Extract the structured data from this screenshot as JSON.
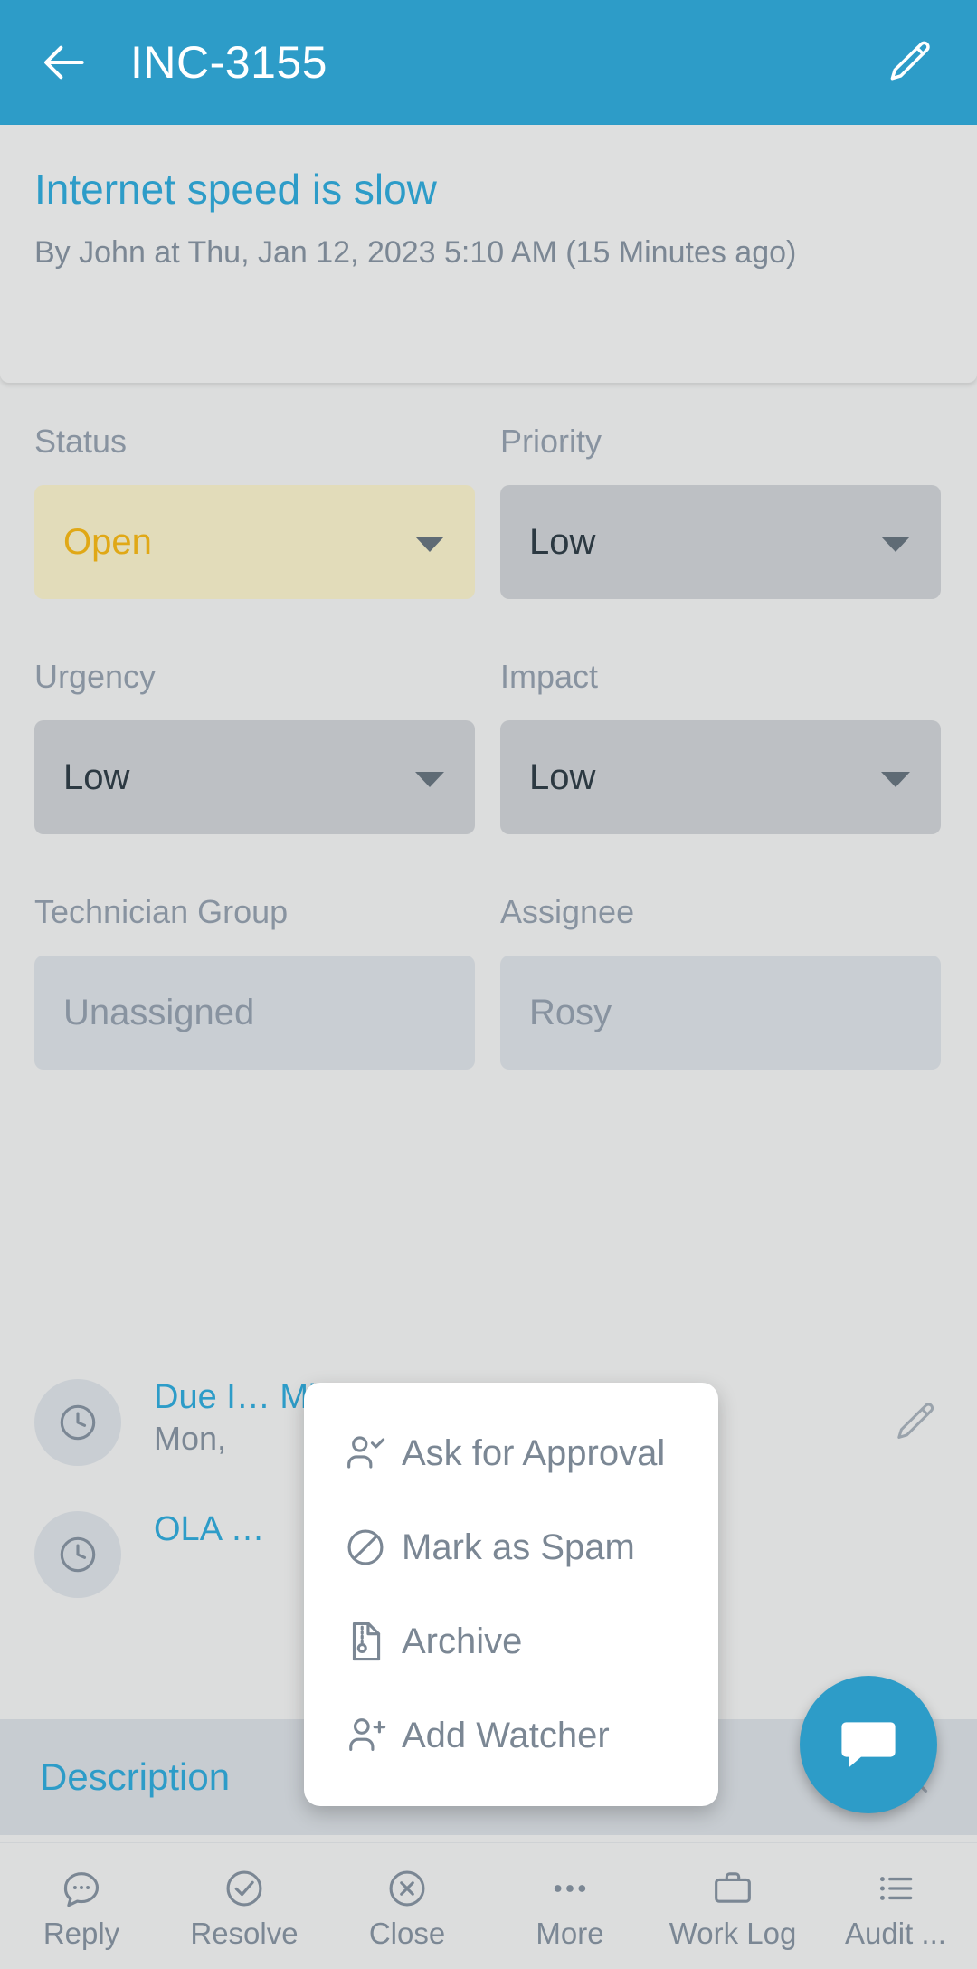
{
  "appbar": {
    "back_icon": "arrow-left-icon",
    "title": "INC-3155",
    "edit_icon": "pencil-icon",
    "background_color": "#2d9cc8"
  },
  "summary": {
    "title": "Internet speed is slow",
    "meta": "By John at Thu, Jan 12, 2023 5:10 AM (15 Minutes ago)",
    "title_color": "#2d9cc8"
  },
  "fields": [
    {
      "label": "Status",
      "value": "Open",
      "type": "dropdown",
      "background_color": "#e2dcba",
      "value_color": "#e0a816"
    },
    {
      "label": "Priority",
      "value": "Low",
      "type": "dropdown",
      "background_color": "#bdc0c4",
      "value_color": "#2c3942"
    },
    {
      "label": "Urgency",
      "value": "Low",
      "type": "dropdown",
      "background_color": "#bdc0c4",
      "value_color": "#2c3942"
    },
    {
      "label": "Impact",
      "value": "Low",
      "type": "dropdown",
      "background_color": "#bdc0c4",
      "value_color": "#2c3942"
    },
    {
      "label": "Technician Group",
      "value": "Unassigned",
      "type": "readonly",
      "background_color": "#c9ced3",
      "value_color": "#8893a0"
    },
    {
      "label": "Assignee",
      "value": "Rosy",
      "type": "readonly",
      "background_color": "#c9ced3",
      "value_color": "#8893a0"
    }
  ],
  "sla": [
    {
      "avatar_icon": "clock-icon",
      "title": "Due I… Minut…",
      "subtitle": "Mon,",
      "edit_icon": "pencil-icon"
    },
    {
      "avatar_icon": "clock-icon",
      "title": "OLA …",
      "subtitle": "",
      "edit_icon": ""
    }
  ],
  "tabstrip": {
    "label": "Description",
    "search_icon": "search-icon"
  },
  "fab": {
    "icon": "chat-bubble-icon",
    "color": "#2d9cc8"
  },
  "popup": {
    "items": [
      {
        "label": "Ask for Approval",
        "icon": "person-check-icon"
      },
      {
        "label": "Mark as Spam",
        "icon": "block-circle-icon"
      },
      {
        "label": "Archive",
        "icon": "archive-file-icon"
      },
      {
        "label": "Add Watcher",
        "icon": "person-plus-icon"
      }
    ]
  },
  "bottomnav": {
    "items": [
      {
        "label": "Reply",
        "icon": "chat-dots-icon"
      },
      {
        "label": "Resolve",
        "icon": "check-circle-icon"
      },
      {
        "label": "Close",
        "icon": "x-circle-icon"
      },
      {
        "label": "More",
        "icon": "ellipsis-icon"
      },
      {
        "label": "Work Log",
        "icon": "briefcase-icon"
      },
      {
        "label": "Audit ...",
        "icon": "list-icon"
      }
    ]
  }
}
